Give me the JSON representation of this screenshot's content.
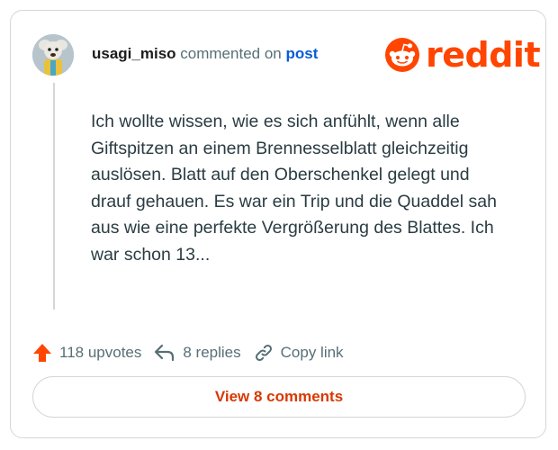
{
  "comment": {
    "author": "usagi_miso",
    "action_text": "commented on",
    "post_link": "post",
    "body": "Ich wollte wissen, wie es sich anfühlt, wenn alle Giftspitzen an einem Brennesselblatt gleichzeitig auslösen. Blatt auf den Oberschenkel gelegt und drauf gehauen. Es war ein Trip und die Quaddel sah aus wie eine perfekte Vergrößerung des Blattes. Ich war schon 13..."
  },
  "brand": {
    "logo_text": "reddit",
    "color": "#ff4500"
  },
  "actions": {
    "upvotes": "118 upvotes",
    "replies": "8 replies",
    "copy_link": "Copy link"
  },
  "footer": {
    "view_comments": "View 8 comments"
  },
  "icons": [
    "avatar",
    "reddit-logo-icon",
    "upvote-icon",
    "reply-icon",
    "link-icon"
  ]
}
